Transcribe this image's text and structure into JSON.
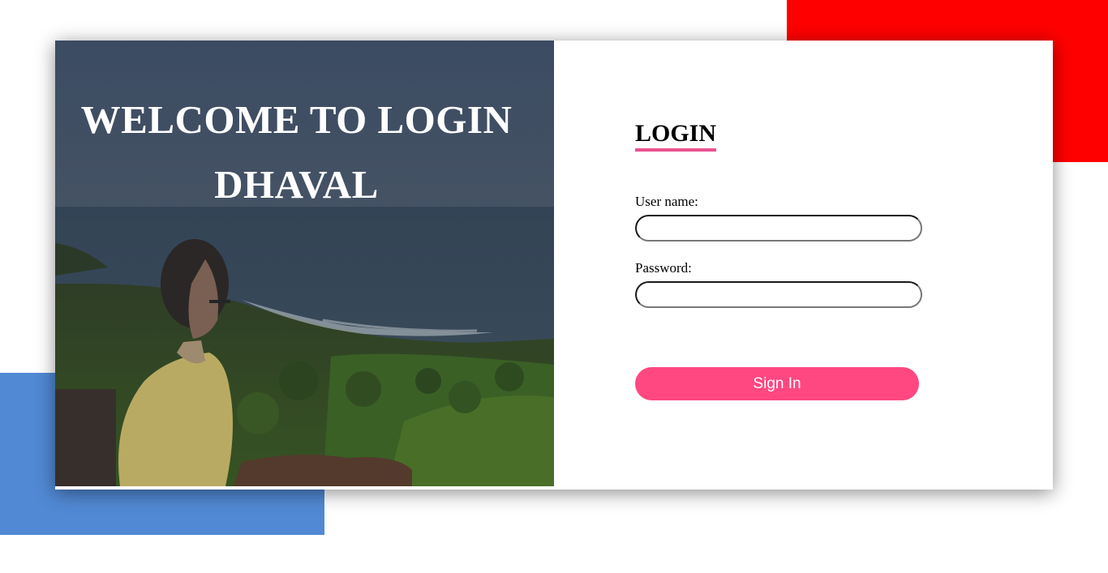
{
  "hero": {
    "title_line1": "WELCOME TO LOGIN",
    "title_line2": "DHAVAL",
    "image_name": "beach-landscape-photo"
  },
  "login": {
    "title": "LOGIN",
    "username_label": "User name:",
    "username_value": "",
    "password_label": "Password:",
    "password_value": "",
    "signin_label": "Sign In"
  },
  "colors": {
    "accent_pink": "#ff4782",
    "underline_pink": "#e8538f",
    "deco_red": "#ff0000",
    "deco_blue": "#5189d4"
  }
}
